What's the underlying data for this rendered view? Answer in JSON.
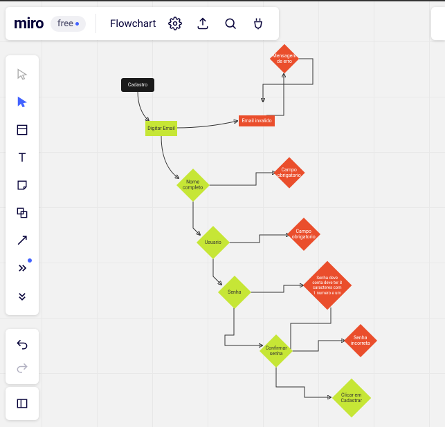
{
  "header": {
    "logo": "miro",
    "plan": "free",
    "board_title": "Flowchart"
  },
  "toolbar": {
    "items": [
      "select",
      "cursor",
      "frame",
      "text",
      "sticky",
      "shape",
      "line",
      "more",
      "expand"
    ]
  },
  "nodes": {
    "cadastro": "Cadastro",
    "digitar_email": "Digitar Email",
    "email_invalido": "Email invalido",
    "mensagem_erro": "Mensagem de erro",
    "nome_completo": "Nome completo",
    "campo_obrig_1": "Campo obrigatorio",
    "usuario": "Usuario",
    "campo_obrig_2": "Campo obrigatorio",
    "senha": "Senha",
    "senha_regras": "Senha deve conta deve ter 8 caracteres com 1 numero e um",
    "confirmar_senha": "Confirmar senha",
    "senha_incorreta": "Senha incorreta",
    "clicar_cadastrar": "Clicar em Cadastrar"
  }
}
